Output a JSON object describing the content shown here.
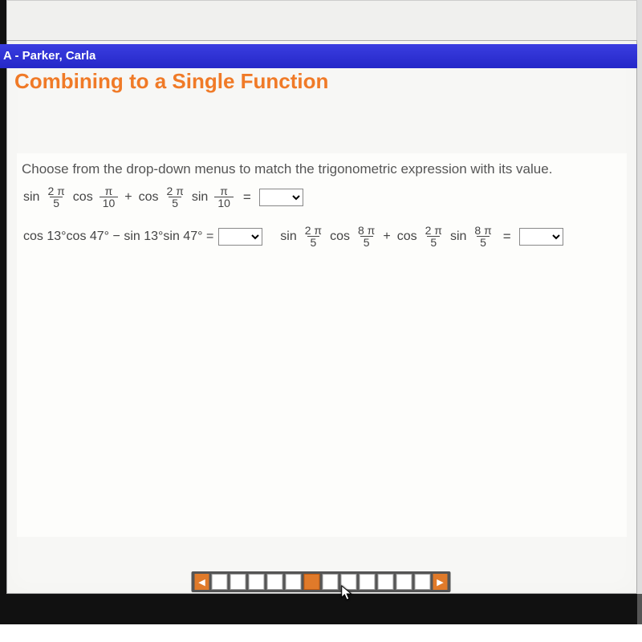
{
  "header": {
    "student": "A - Parker, Carla"
  },
  "title": "Combining to a Single Function",
  "instructions": "Choose from the drop-down menus to match the trigonometric expression with its value.",
  "expr1": {
    "t1_fn": "sin",
    "t1_num": "2 π",
    "t1_den": "5",
    "t2_fn": "cos",
    "t2_num": "π",
    "t2_den": "10",
    "plus": "+",
    "t3_fn": "cos",
    "t3_num": "2 π",
    "t3_den": "5",
    "t4_fn": "sin",
    "t4_num": "π",
    "t4_den": "10",
    "eq": "="
  },
  "expr2": {
    "text": "cos 13°cos 47° − sin 13°sin 47° =",
    "eq": "="
  },
  "expr3": {
    "t1_fn": "sin",
    "t1_num": "2 π",
    "t1_den": "5",
    "t2_fn": "cos",
    "t2_num": "8 π",
    "t2_den": "5",
    "plus": "+",
    "t3_fn": "cos",
    "t3_num": "2 π",
    "t3_den": "5",
    "t4_fn": "sin",
    "t4_num": "8 π",
    "t4_den": "5",
    "eq": "="
  },
  "pager": {
    "prev": "◀",
    "next": "▶",
    "total_cells": 12,
    "active_index": 5
  }
}
